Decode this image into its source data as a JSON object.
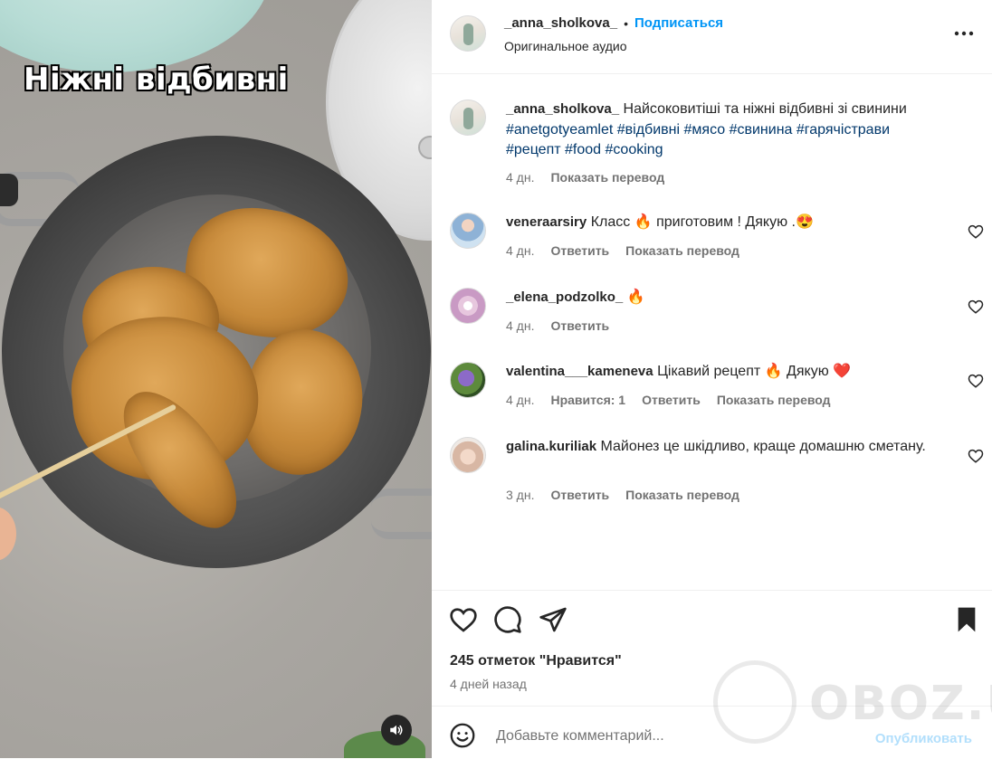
{
  "video": {
    "overlay_title": "Ніжні відбивні"
  },
  "header": {
    "username": "_anna_sholkova_",
    "separator": "•",
    "follow_label": "Подписаться",
    "audio_label": "Оригинальное аудио",
    "more_label": "•••"
  },
  "caption": {
    "username": "_anna_sholkova_",
    "text": "Найсоковитіші та ніжні відбивні зі свинини",
    "hashtags_line1": [
      "#anetgotyeamlet",
      "#відбивні",
      "#мясо",
      "#свинина",
      "#гарячістрави"
    ],
    "hashtags_line2": [
      "#рецепт",
      "#food",
      "#cooking"
    ],
    "time": "4 дн.",
    "translate_label": "Показать перевод"
  },
  "comments": [
    {
      "username": "veneraarsiry",
      "text": "Класс 🔥 приготовим ! Дякую .😍",
      "time": "4 дн.",
      "likes": "",
      "reply_label": "Ответить",
      "translate_label": "Показать перевод"
    },
    {
      "username": "_elena_podzolko_",
      "text": "🔥",
      "time": "4 дн.",
      "likes": "",
      "reply_label": "Ответить",
      "translate_label": ""
    },
    {
      "username": "valentina___kameneva",
      "text": "Цікавий рецепт 🔥 Дякую ❤️",
      "time": "4 дн.",
      "likes": "Нравится: 1",
      "reply_label": "Ответить",
      "translate_label": "Показать перевод"
    },
    {
      "username": "galina.kuriliak",
      "text": "Майонез це шкідливо, краще домашню сметану.",
      "time": "3 дн.",
      "likes": "",
      "reply_label": "Ответить",
      "translate_label": "Показать перевод"
    }
  ],
  "actions": {
    "likes_count": "245 отметок \"Нравится\"",
    "posted": "4 дней назад"
  },
  "composer": {
    "placeholder": "Добавьте комментарий...",
    "publish_label": "Опубликовать"
  },
  "watermark": {
    "text": "OBOZ.UA"
  },
  "icons": {
    "like": "heart-icon",
    "comment": "comment-icon",
    "share": "share-icon",
    "save": "bookmark-icon",
    "emoji": "emoji-icon",
    "sound": "speaker-icon",
    "more": "more-icon"
  }
}
